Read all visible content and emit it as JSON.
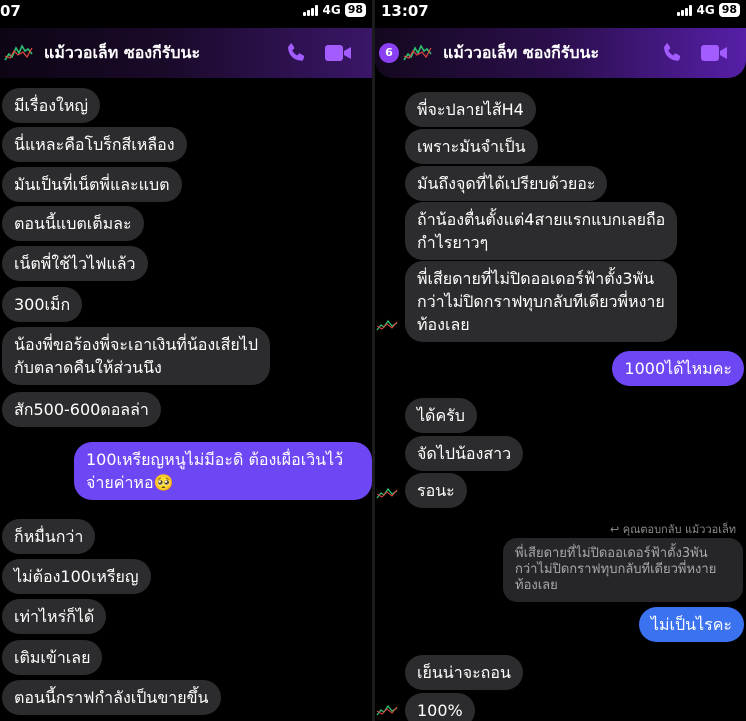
{
  "left": {
    "status": {
      "time": "07",
      "network": "4G",
      "battery": "98"
    },
    "contact_name": "แม้ววอเล็ท ซองกีรับนะ",
    "messages_in_1": [
      "มีเรื่องใหญ่",
      "นี่แหละคือโบร็กสีเหลือง",
      "มันเป็นที่เน็ตพี่และแบต",
      "ตอนนี้แบตเต็มละ",
      "เน็ตพี่ใช้ไวไฟแล้ว",
      "300เม็ก"
    ],
    "messages_in_2": {
      "line1": "น้องพี่ขอร้องพี่จะเอาเงินที่น้องเสียไป",
      "line2": "กับตลาดคืนให้ส่วนนึง"
    },
    "messages_in_3": "สัก500-600ดอลล่า",
    "message_out": {
      "line1": "100เหรียญหนูไม่มีอะดิ ต้องเผื่อเวินไว้",
      "line2": "จ่ายค่าหอ",
      "emoji": "🥺"
    },
    "messages_in_4": [
      "ก็หมื่นกว่า",
      "ไม่ต้อง100เหรียญ",
      "เท่าไหร่ก็ได้",
      "เติมเข้าเลย",
      "ตอนนี้กราฟกำลังเป็นขายขึ้น"
    ]
  },
  "right": {
    "status": {
      "time": "13:07",
      "network": "4G",
      "battery": "98"
    },
    "badge": "6",
    "contact_name": "แม้ววอเล็ท ซองกีรับนะ",
    "messages_in_1": [
      "พี่จะปลายไส้H4",
      "เพราะมันจำเป็น",
      "มันถึงจุดที่ได้เปรียบด้วยอะ"
    ],
    "msg_two_lines": {
      "line1": "ถ้าน้องตื่นตั้งแต่4สายแรกแบกเลยถือ",
      "line2": "กำไรยาวๆ"
    },
    "msg_three_lines": {
      "line1": "พี่เสียดายที่ไม่ปิดออเดอร์ฟ้าตั้ง3พัน",
      "line2": "กว่าไม่ปิดกราฟทุบกลับทีเดียวพี่หงาย",
      "line3": "ท้องเลย"
    },
    "message_out_1": "1000ได้ไหมคะ",
    "messages_in_2": [
      "ได้ครับ",
      "จัดไปน้องสาว",
      "รอนะ"
    ],
    "reply_label": "คุณตอบกลับ แม้ววอเล็ท",
    "quote": {
      "line1": "พี่เสียดายที่ไม่ปิดออเดอร์ฟ้าตั้ง3พัน",
      "line2": "กว่าไม่ปิดกราฟทุบกลับทีเดียวพี่หงาย",
      "line3": "ท้องเลย"
    },
    "message_out_2": "ไม่เป็นไรคะ",
    "messages_in_3": [
      "เย็นน่าจะถอน",
      "100%"
    ]
  },
  "colors": {
    "incoming_bubble": "#2c2c2e",
    "outgoing_bubble": "#6e47f5",
    "outgoing_bubble_blue": "#3a72ef",
    "accent_icons": "#a35cff"
  },
  "icons": [
    "signal-icon",
    "battery-icon",
    "phone-icon",
    "video-icon",
    "chart-avatar-icon"
  ]
}
